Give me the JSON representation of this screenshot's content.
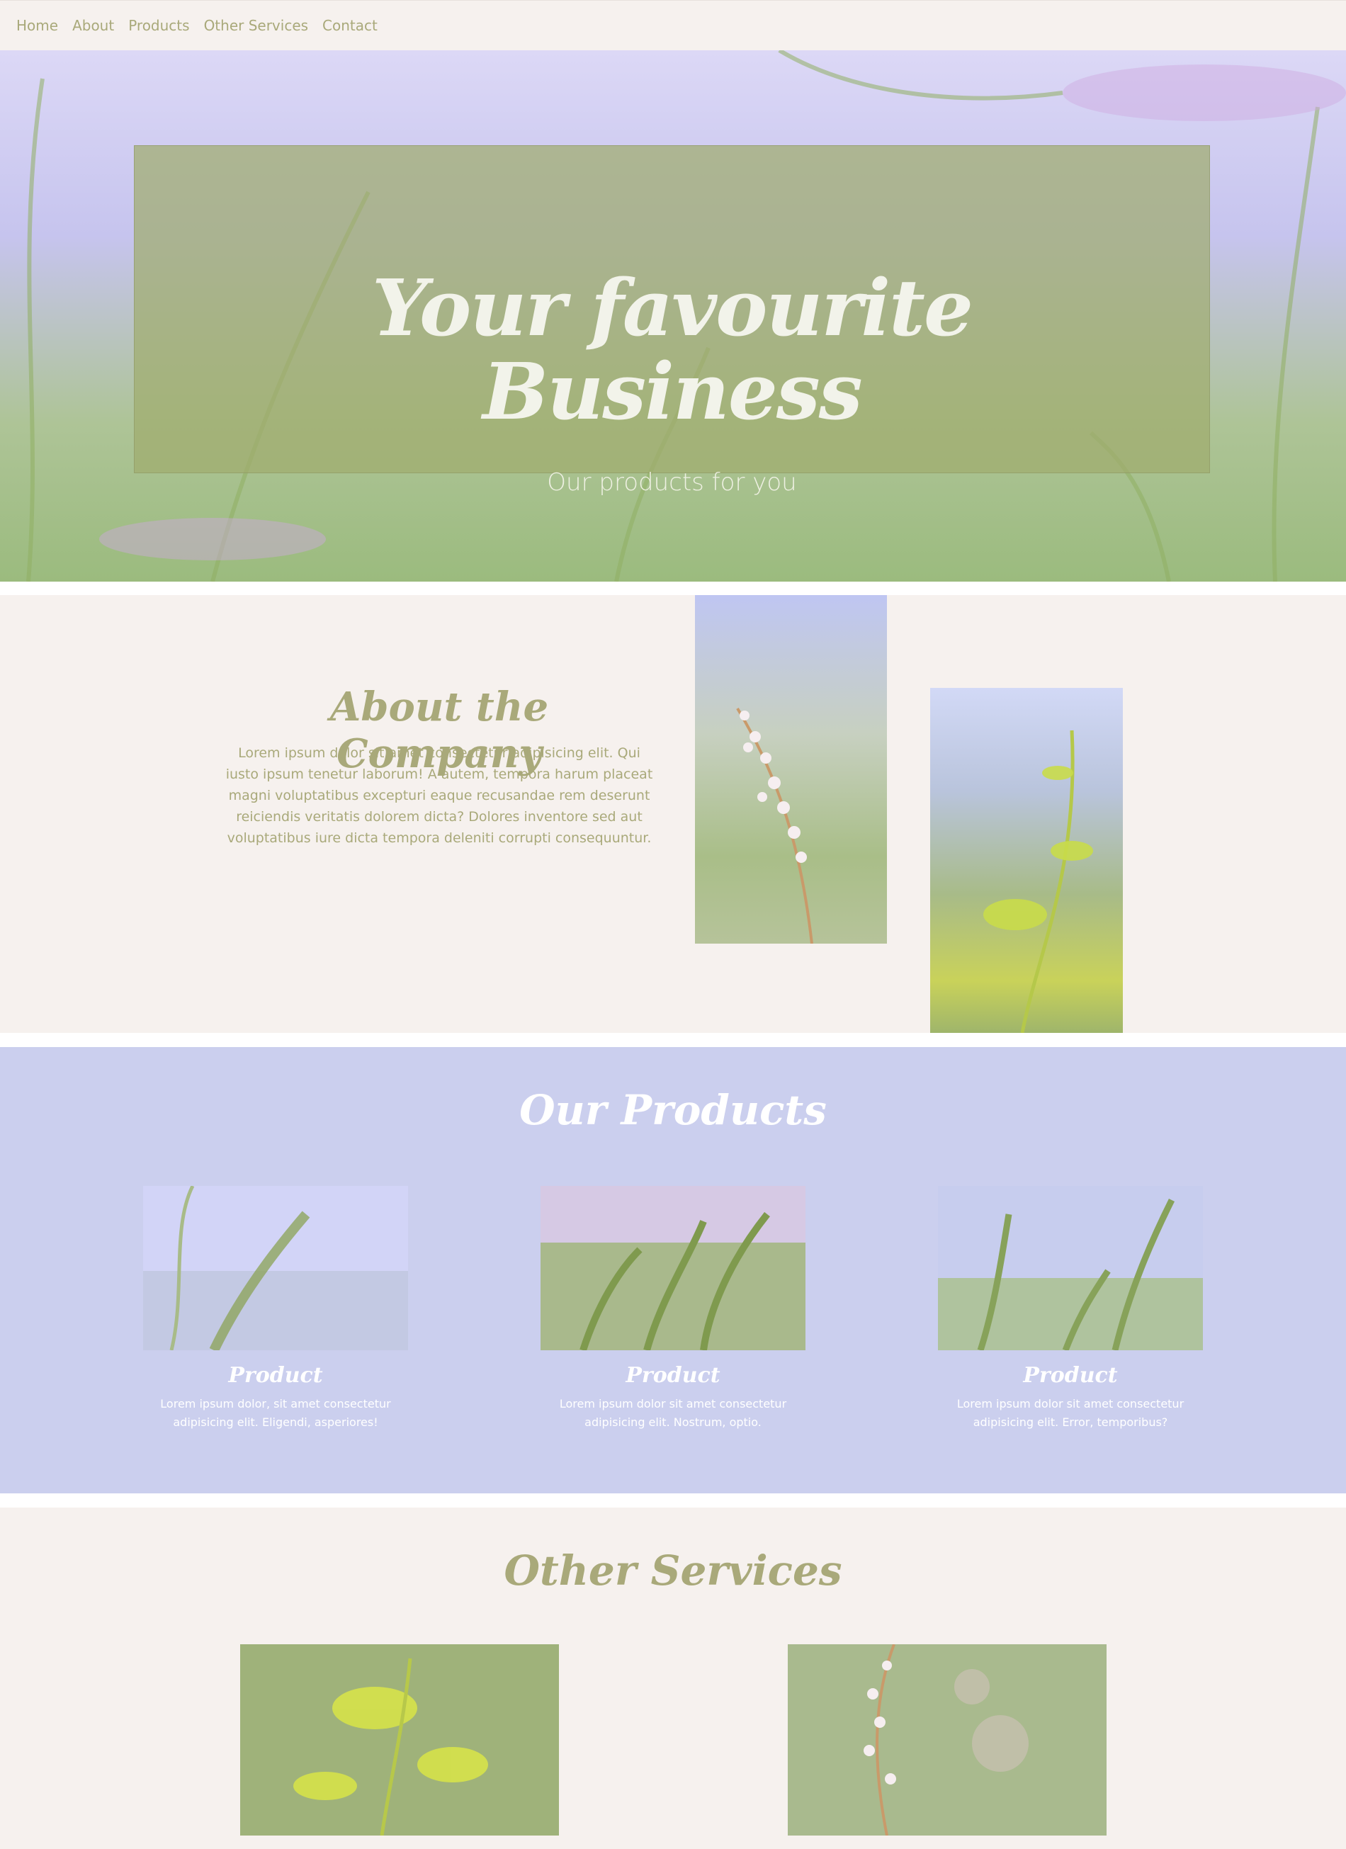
{
  "nav": {
    "items": [
      "Home",
      "About",
      "Products",
      "Other Services",
      "Contact"
    ]
  },
  "hero": {
    "title_line1": "Your favourite",
    "title_line2": "Business",
    "subtitle": "Our products for you"
  },
  "about": {
    "title": "About the Company",
    "text": "Lorem ipsum dolor sit amet consectetur adipisicing elit. Qui iusto ipsum tenetur laborum! A autem, tempora harum placeat magni voluptatibus excepturi eaque recusandae rem deserunt reiciendis veritatis dolorem dicta? Dolores inventore sed aut voluptatibus iure dicta tempora deleniti corrupti consequuntur."
  },
  "products": {
    "title": "Our Products",
    "items": [
      {
        "name": "Product",
        "desc": "Lorem ipsum dolor, sit amet consectetur adipisicing elit. Eligendi, asperiores!"
      },
      {
        "name": "Product",
        "desc": "Lorem ipsum dolor sit amet consectetur adipisicing elit. Nostrum, optio."
      },
      {
        "name": "Product",
        "desc": "Lorem ipsum dolor sit amet consectetur adipisicing elit. Error, temporibus?"
      }
    ]
  },
  "services": {
    "title": "Other Services"
  },
  "colors": {
    "nav_bg": "#f6f1ee",
    "accent_olive": "#a9a97a",
    "products_bg": "#cbcfee",
    "white": "#ffffff"
  }
}
